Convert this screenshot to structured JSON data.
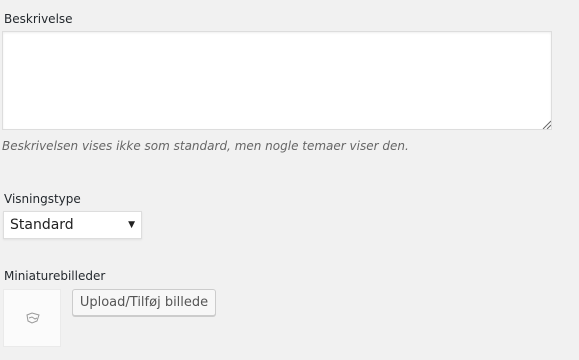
{
  "description": {
    "label": "Beskrivelse",
    "value": "",
    "help": "Beskrivelsen vises ikke som standard, men nogle temaer viser den."
  },
  "view_type": {
    "label": "Visningstype",
    "selected": "Standard"
  },
  "thumbnail": {
    "label": "Miniaturebilleder",
    "button_label": "Upload/Tilføj billede",
    "placeholder_icon": "image-placeholder-icon"
  }
}
